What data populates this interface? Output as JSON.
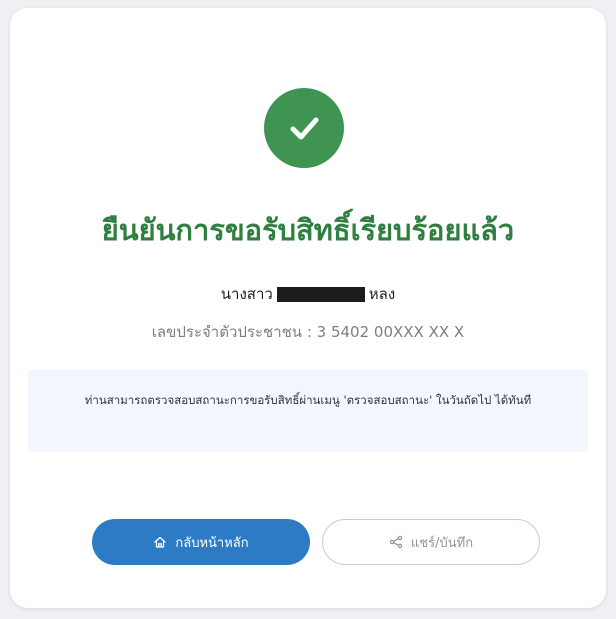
{
  "title": "ยืนยันการขอรับสิทธิ์เรียบร้อยแล้ว",
  "person": {
    "prefix": "นางสาว",
    "suffix": "หลง"
  },
  "id_line": "เลขประจำตัวประชาชน : 3 5402 00XXX XX X",
  "info_message": "ท่านสามารถตรวจสอบสถานะการขอรับสิทธิ์ผ่านเมนู 'ตรวจสอบสถานะ' ในวันถัดไป ได้ทันที",
  "buttons": {
    "home_label": "กลับหน้าหลัก",
    "share_label": "แชร์/บันทึก"
  },
  "icons": {
    "success": "check-circle-icon",
    "home": "home-icon",
    "share": "share-icon"
  },
  "colors": {
    "success": "#3f9452",
    "title": "#2f7f40",
    "primary_button": "#2e7bc5"
  }
}
